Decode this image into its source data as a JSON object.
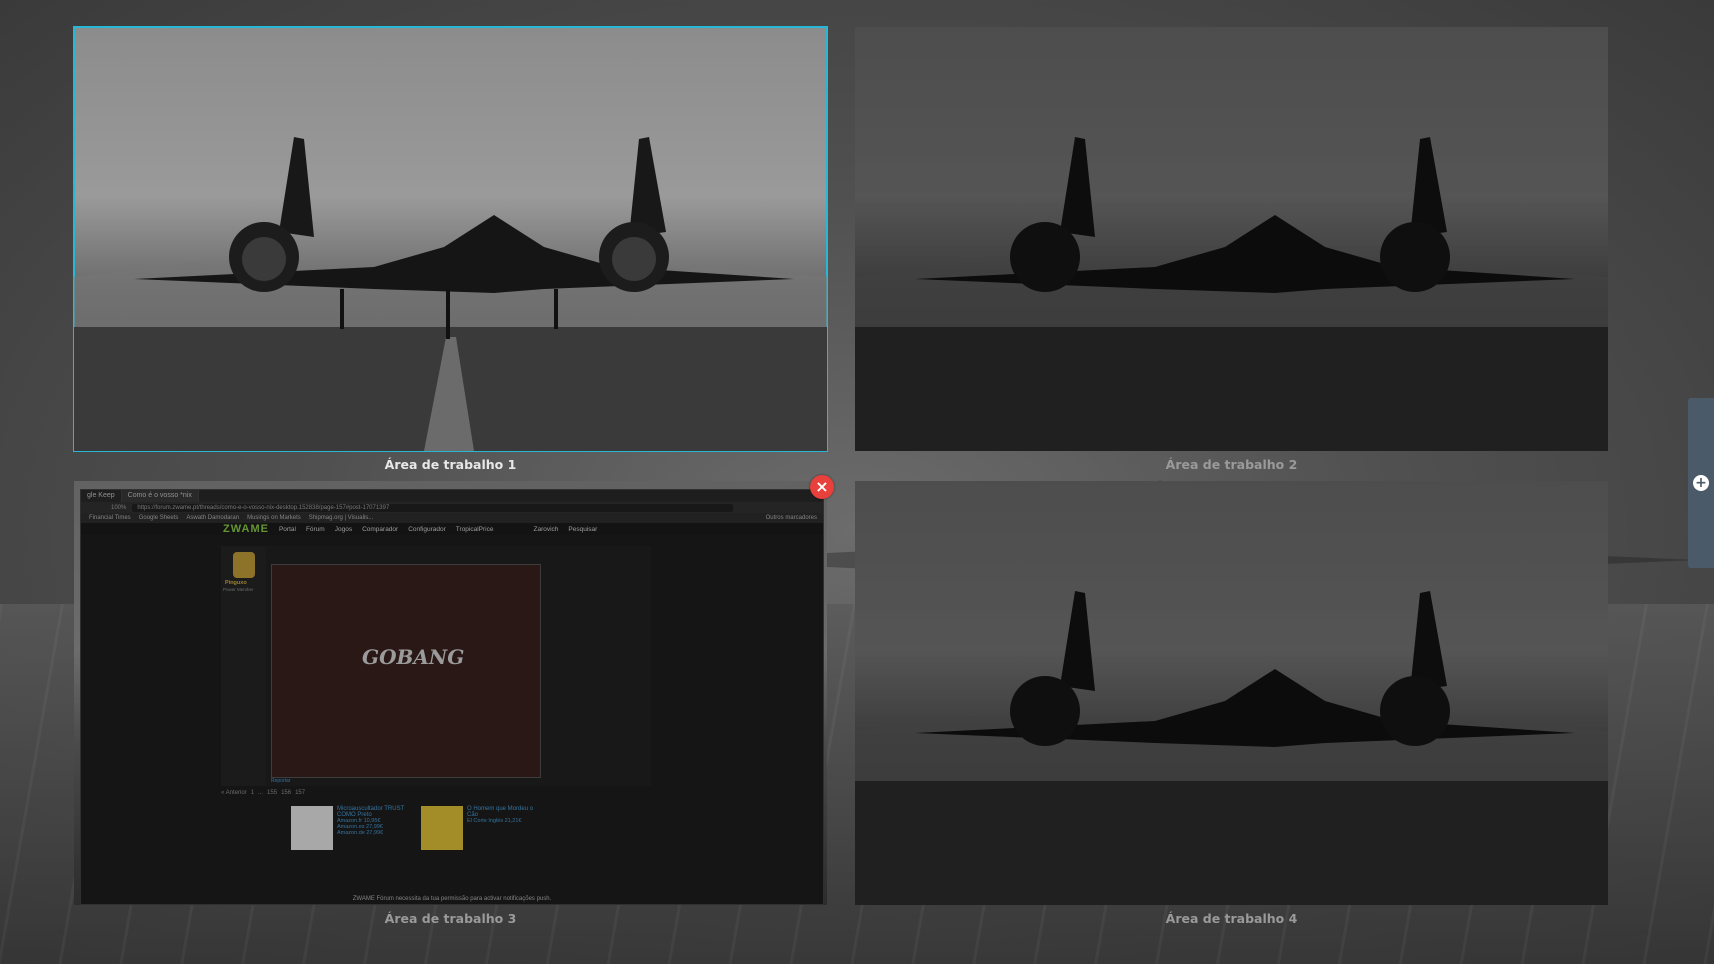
{
  "workspaces": [
    {
      "label": "Área de trabalho 1"
    },
    {
      "label": "Área de trabalho 2"
    },
    {
      "label": "Área de trabalho 3"
    },
    {
      "label": "Área de trabalho 4"
    }
  ],
  "browser": {
    "tabs": [
      "gle Keep",
      "Como é o vosso *nix"
    ],
    "url": "https://forum.zwame.pt/threads/como-e-o-vosso-nix-desktop.152838/page-157#post-17071397",
    "zoom": "100%",
    "bookmarks": [
      "Financial Times",
      "Google Sheets",
      "Aswath Damodaran",
      "Musings on Markets",
      "Shipmag.org | Visualis...",
      "Outros marcadores"
    ],
    "nav": {
      "logo": "ZWAME",
      "items": [
        "Portal",
        "Fórum",
        "Jogos",
        "Comparador",
        "Configurador",
        "TropicalPrice"
      ],
      "user": "Zarovich",
      "search": "Pesquisar"
    },
    "post": {
      "username": "Pinguxo",
      "usertitle": "Power Member",
      "image_text": "GOBANG",
      "report": "Reportar"
    },
    "pager": [
      "« Anterior",
      "1",
      "...",
      "155",
      "156",
      "157"
    ],
    "ads": [
      {
        "title": "Microauscultador TRUST COMO Preto",
        "shops": [
          "Amazon.fr",
          "Amazon.es",
          "Amazon.de"
        ],
        "prices": [
          "10,95€",
          "27,99€",
          "27,99€"
        ]
      },
      {
        "title": "O Homem que Mordeu o Cão",
        "shops": [
          "El Corte Inglés"
        ],
        "prices": [
          "21,21€"
        ]
      }
    ],
    "notice": "ZWAME Fórum necessita da tua permissão para activar notificações push."
  },
  "close_label": "×",
  "add_label": "+"
}
